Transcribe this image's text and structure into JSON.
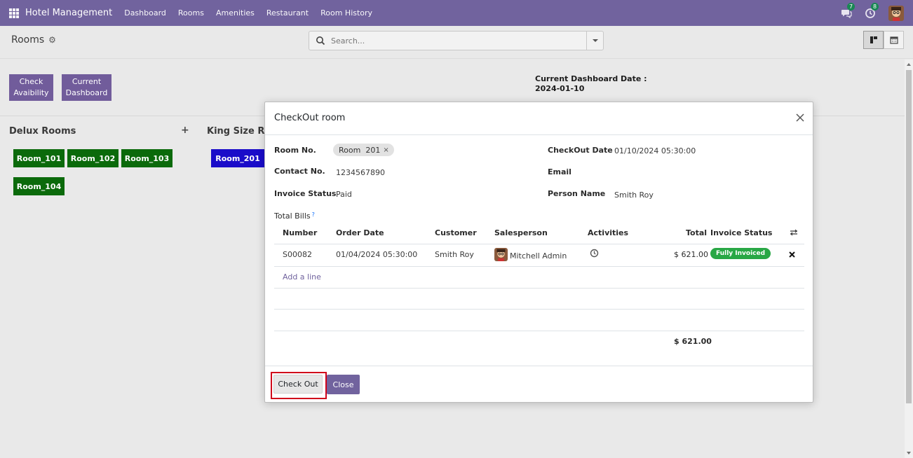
{
  "navbar": {
    "brand": "Hotel Management",
    "menu": [
      "Dashboard",
      "Rooms",
      "Amenities",
      "Restaurant",
      "Room History"
    ],
    "messages_count": "7",
    "activities_count": "8",
    "icons": [
      "apps-icon",
      "chat-icon",
      "clock-icon",
      "avatar"
    ]
  },
  "control_panel": {
    "breadcrumb": "Rooms",
    "search_placeholder": "Search..."
  },
  "dashboard": {
    "check_availability": [
      "Check",
      "Avaibility"
    ],
    "current_dashboard": [
      "Current",
      "Dashboard"
    ],
    "date_label": "Current Dashboard Date :",
    "date_value": "2024-01-10",
    "columns": [
      {
        "title": "Delux Rooms",
        "add": "+"
      },
      {
        "title": "King Size Roo"
      }
    ],
    "rooms": [
      "Room_101",
      "Room_102",
      "Room_103",
      "Room_104",
      "Room_201"
    ]
  },
  "modal": {
    "title": "CheckOut room",
    "fields": {
      "room_no_label": "Room No.",
      "room_no_tag": "Room  201",
      "tag_remove": "×",
      "contact_label": "Contact No.",
      "contact_value": "1234567890",
      "invoice_status_label": "Invoice Status",
      "invoice_status_value": "Paid",
      "checkout_date_label": "CheckOut Date",
      "checkout_date_value": "01/10/2024 05:30:00",
      "email_label": "Email",
      "person_name_label": "Person Name",
      "person_name_value": "Smith Roy",
      "total_bills_label": "Total Bills",
      "help": "?"
    },
    "table": {
      "headers": [
        "Number",
        "Order Date",
        "Customer",
        "Salesperson",
        "Activities",
        "Total",
        "Invoice Status"
      ],
      "rows": [
        {
          "number": "S00082",
          "order_date": "01/04/2024 05:30:00",
          "customer": "Smith Roy",
          "salesperson": "Mitchell Admin",
          "total": "$ 621.00",
          "invoice_status": "Fully Invoiced"
        }
      ],
      "add_line": "Add a line",
      "grand_total": "$ 621.00"
    },
    "footer": {
      "checkout_button": "Check Out",
      "close_button": "Close"
    }
  },
  "colors": {
    "brand": "#71639e",
    "room_green": "#0b6a0b",
    "room_blue": "#1a0cc9",
    "status_green": "#28a745",
    "highlight": "#d0021b"
  }
}
